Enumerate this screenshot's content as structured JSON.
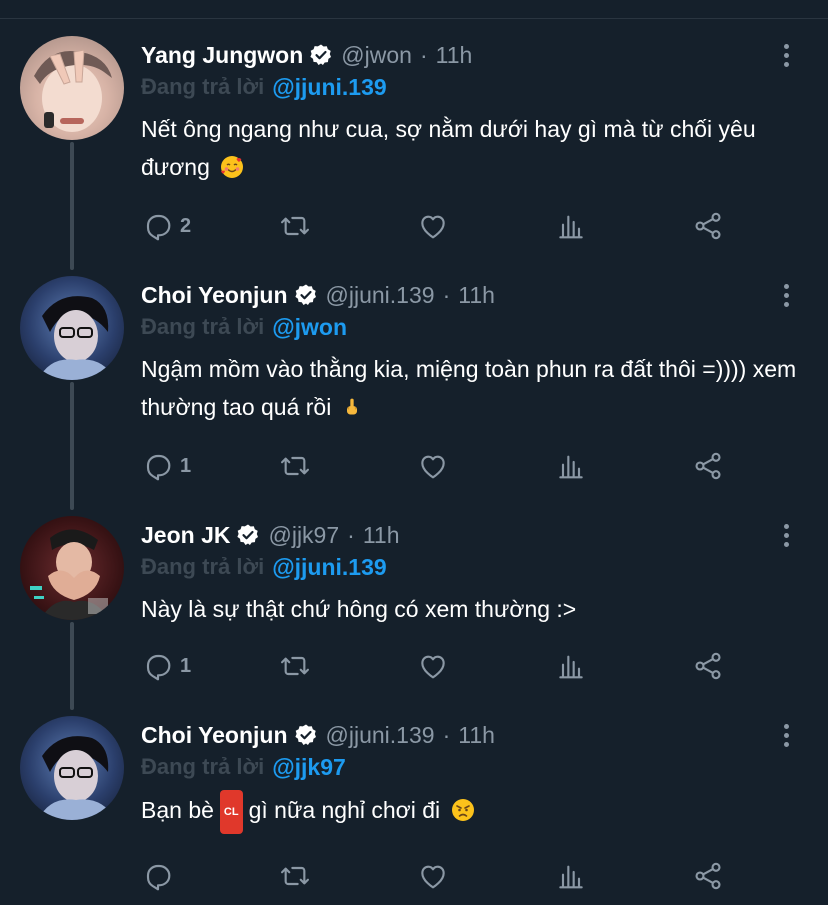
{
  "reply_prefix": "Đang trả lời",
  "tweets": [
    {
      "name": "Yang Jungwon",
      "handle": "@jwon",
      "time": "11h",
      "reply_to": "@jjuni.139",
      "text": "Nết ông ngang như cua, sợ nằm dưới hay gì mà từ chối yêu đương",
      "emoji": "smiling-face-with-hearts",
      "stats": {
        "replies": "2",
        "retweets": "",
        "likes": ""
      }
    },
    {
      "name": "Choi Yeonjun",
      "handle": "@jjuni.139",
      "time": "11h",
      "reply_to": "@jwon",
      "text": "Ngậm mồm vào thằng kia, miệng toàn phun ra đất thôi =)))) xem thường tao quá rồi",
      "emoji": "middle-finger",
      "stats": {
        "replies": "1",
        "retweets": "",
        "likes": ""
      }
    },
    {
      "name": "Jeon JK",
      "handle": "@jjk97",
      "time": "11h",
      "reply_to": "@jjuni.139",
      "text": "Này là sự thật chứ hông có xem thường :>",
      "emoji": "",
      "stats": {
        "replies": "1",
        "retweets": "",
        "likes": ""
      }
    },
    {
      "name": "Choi Yeonjun",
      "handle": "@jjuni.139",
      "time": "11h",
      "reply_to": "@jjk97",
      "text_before": "Bạn bè",
      "badge": "CL",
      "text_after": "gì nữa nghỉ chơi đi",
      "emoji": "angry-face",
      "stats": {
        "replies": "",
        "retweets": "",
        "likes": ""
      }
    }
  ],
  "colors": {
    "background": "#15202b",
    "secondary_text": "#8b98a5",
    "link": "#1d9bf0",
    "thread_line": "#3d4954"
  }
}
